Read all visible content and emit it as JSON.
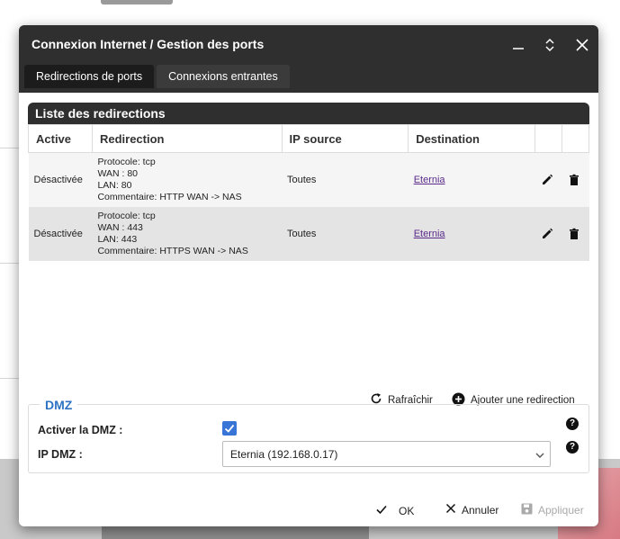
{
  "dialog": {
    "title": "Connexion Internet / Gestion des ports",
    "tabs": [
      {
        "label": "Redirections de ports",
        "active": true
      },
      {
        "label": "Connexions entrantes",
        "active": false
      }
    ]
  },
  "list": {
    "header": "Liste des redirections",
    "columns": [
      "Active",
      "Redirection",
      "IP source",
      "Destination"
    ],
    "rows": [
      {
        "active": "Désactivée",
        "redirection": [
          "Protocole: tcp",
          "WAN : 80",
          "LAN: 80",
          "Commentaire: HTTP WAN -> NAS"
        ],
        "ip_source": "Toutes",
        "destination": "Eternia"
      },
      {
        "active": "Désactivée",
        "redirection": [
          "Protocole: tcp",
          "WAN : 443",
          "LAN: 443",
          "Commentaire: HTTPS WAN -> NAS"
        ],
        "ip_source": "Toutes",
        "destination": "Eternia"
      }
    ],
    "refresh_label": "Rafraîchir",
    "add_label": "Ajouter une redirection"
  },
  "dmz": {
    "legend": "DMZ",
    "enable_label": "Activer la DMZ :",
    "enabled": true,
    "ip_label": "IP DMZ :",
    "ip_value": "Eternia (192.168.0.17)"
  },
  "footer": {
    "ok_label": "OK",
    "cancel_label": "Annuler",
    "apply_label": "Appliquer"
  },
  "colors": {
    "titlebar": "#2f2f2f",
    "accent": "#2f72c4",
    "checkbox": "#3875d7",
    "link": "#5a2a8a"
  }
}
